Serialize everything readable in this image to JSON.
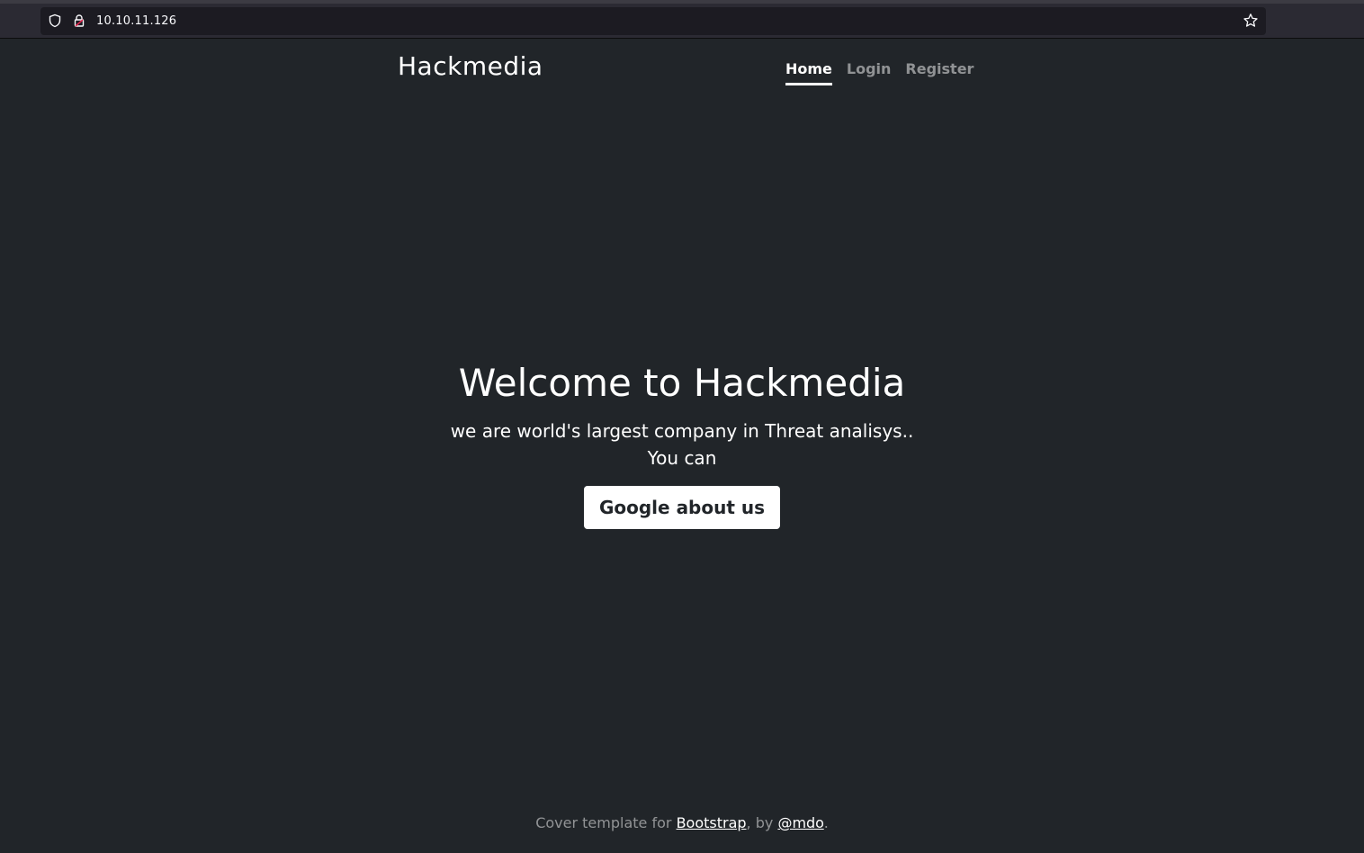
{
  "browser": {
    "url": "10.10.11.126",
    "icons": [
      "shield-icon",
      "lock-icon",
      "star-icon"
    ]
  },
  "header": {
    "brand": "Hackmedia",
    "nav": [
      {
        "label": "Home",
        "active": true
      },
      {
        "label": "Login",
        "active": false
      },
      {
        "label": "Register",
        "active": false
      }
    ]
  },
  "hero": {
    "title": "Welcome to Hackmedia",
    "lead": "we are world's largest company in Threat analisys.. You can",
    "button_label": "Google about us"
  },
  "footer": {
    "prefix": "Cover template for ",
    "link1": "Bootstrap",
    "middle": ", by ",
    "link2": "@mdo",
    "suffix": "."
  },
  "colors": {
    "background": "#212529",
    "chrome": "#2b2a33",
    "url_bar": "#1c1b22",
    "text": "#ffffff",
    "muted": "rgba(255,255,255,0.5)"
  }
}
